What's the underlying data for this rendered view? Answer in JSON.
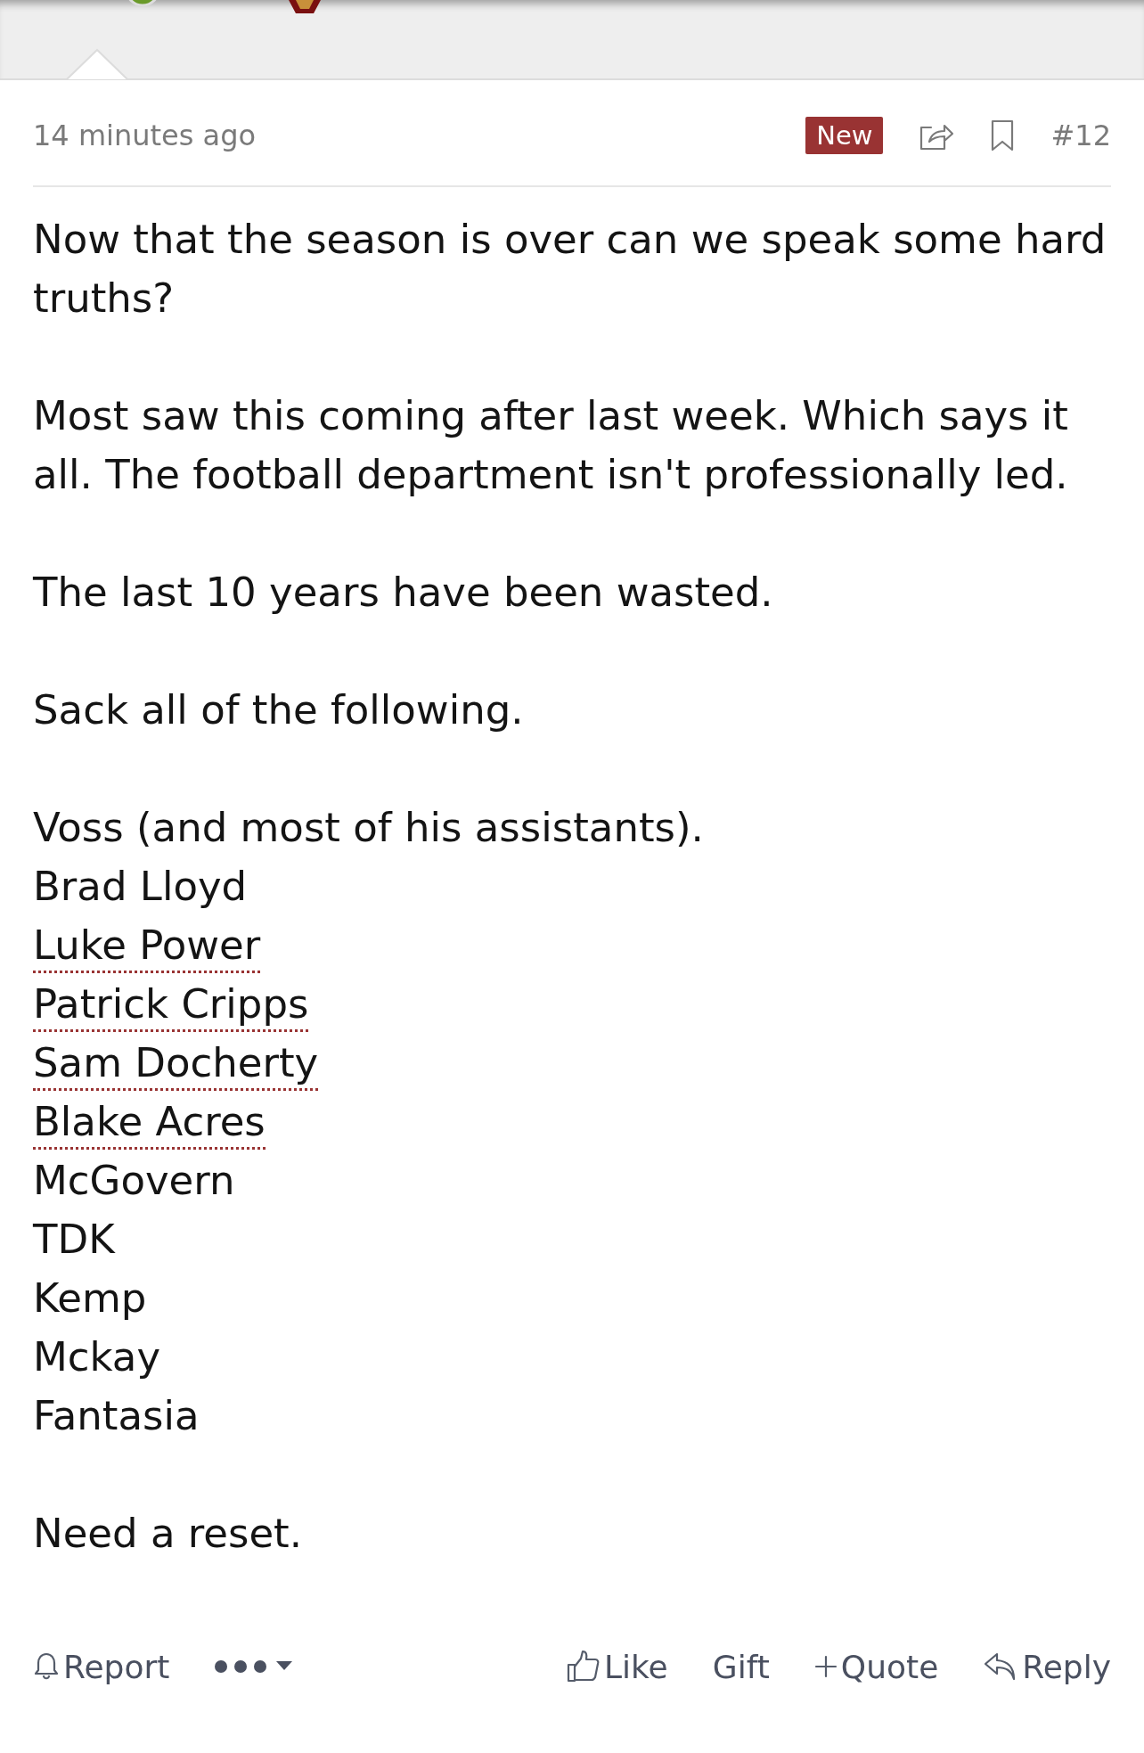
{
  "post": {
    "time": "14 minutes ago",
    "badge": "New",
    "number": "#12",
    "paragraphs": [
      [
        {
          "kind": "text",
          "text": "Now that the season is over can we speak some hard truths?"
        }
      ],
      [
        {
          "kind": "text",
          "text": "Most saw this coming after last week. Which says it all. The football department isn't professionally led."
        }
      ],
      [
        {
          "kind": "text",
          "text": "The last 10 years have been wasted."
        }
      ],
      [
        {
          "kind": "text",
          "text": "Sack all of the following."
        }
      ],
      [
        {
          "kind": "text",
          "text": "Voss (and most of his assistants)."
        },
        {
          "kind": "text",
          "text": "Brad Lloyd"
        },
        {
          "kind": "link",
          "text": "Luke Power"
        },
        {
          "kind": "link",
          "text": "Patrick Cripps"
        },
        {
          "kind": "link",
          "text": "Sam Docherty"
        },
        {
          "kind": "link",
          "text": "Blake Acres"
        },
        {
          "kind": "text",
          "text": "McGovern"
        },
        {
          "kind": "text",
          "text": "TDK"
        },
        {
          "kind": "text",
          "text": "Kemp"
        },
        {
          "kind": "text",
          "text": "Mckay"
        },
        {
          "kind": "text",
          "text": "Fantasia"
        }
      ],
      [
        {
          "kind": "text",
          "text": "Need a reset."
        }
      ]
    ],
    "actions_left": [
      {
        "kind": "report",
        "label": "Report"
      },
      {
        "kind": "more"
      }
    ],
    "actions_right": [
      {
        "kind": "like",
        "label": "Like"
      },
      {
        "kind": "plain",
        "label": "Gift"
      },
      {
        "kind": "quote",
        "label": "Quote"
      },
      {
        "kind": "reply",
        "label": "Reply"
      }
    ]
  }
}
